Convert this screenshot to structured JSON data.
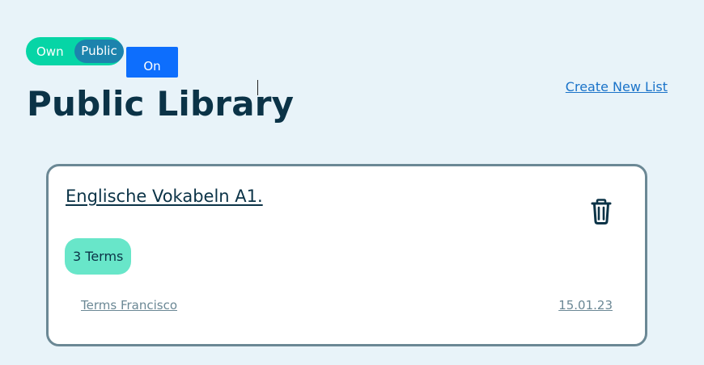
{
  "visibility_toggle": {
    "own_label": "Own",
    "public_label": "Public",
    "selected": "Public"
  },
  "on_button": {
    "label": "On"
  },
  "page": {
    "title": "Public Library",
    "create_link": "Create New List"
  },
  "colors": {
    "background": "#e8f3f9",
    "toggle_track": "#06d5a6",
    "toggle_knob": "#1c83ad",
    "primary_button": "#0d6efd",
    "title_text": "#0b3347",
    "link": "#1a73c9",
    "card_border": "#6b8895",
    "badge": "#68e6c9"
  },
  "lists": [
    {
      "title": "Englische Vokabeln A1.",
      "terms_count": "3 Terms",
      "author": "Terms Francisco",
      "date": "15.01.23",
      "delete_icon": "trash-icon"
    }
  ]
}
